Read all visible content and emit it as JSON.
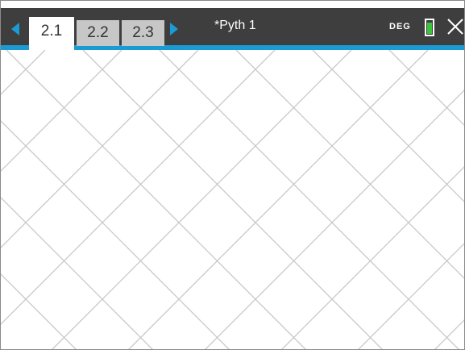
{
  "header": {
    "tabs": [
      {
        "label": "2.1",
        "active": true
      },
      {
        "label": "2.2",
        "active": false
      },
      {
        "label": "2.3",
        "active": false
      }
    ],
    "document_title": "*Pyth 1",
    "angle_mode": "DEG",
    "battery_level": 0.78
  },
  "colors": {
    "header_bg": "#3e3e3e",
    "accent": "#1b9ad4",
    "tab_inactive": "#c7c7c7",
    "grid_line": "#c8c8c8",
    "battery": "#3cc43c"
  },
  "icons": {
    "prev": "triangle-left-icon",
    "next": "triangle-right-icon",
    "battery": "battery-icon",
    "close": "close-icon"
  },
  "graph": {
    "grid_style": "diagonal-lattice"
  }
}
